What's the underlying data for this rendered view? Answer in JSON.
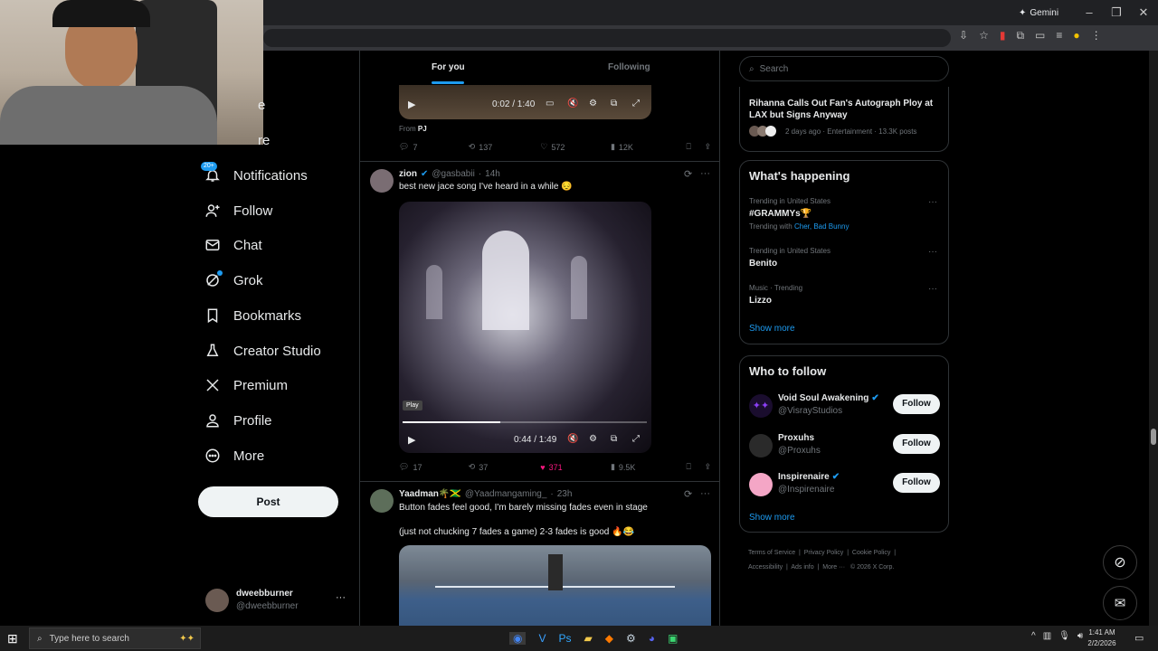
{
  "browser": {
    "gemini_label": "Gemini"
  },
  "tabs": {
    "for_you": "For you",
    "following": "Following"
  },
  "sidebar": {
    "notif_badge": "20+",
    "items": [
      {
        "label": "Notifications",
        "icon": "bell-icon"
      },
      {
        "label": "Follow",
        "icon": "add-user-icon"
      },
      {
        "label": "Chat",
        "icon": "mail-icon"
      },
      {
        "label": "Grok",
        "icon": "grok-icon"
      },
      {
        "label": "Bookmarks",
        "icon": "bookmark-icon"
      },
      {
        "label": "Creator Studio",
        "icon": "flask-icon"
      },
      {
        "label": "Premium",
        "icon": "x-logo-icon"
      },
      {
        "label": "Profile",
        "icon": "person-icon"
      },
      {
        "label": "More",
        "icon": "more-circle-icon"
      }
    ],
    "post_button": "Post",
    "account": {
      "name": "dweebburner",
      "handle": "@dweebburner"
    }
  },
  "post1": {
    "video_time": "0:02 / 1:40",
    "from_label": "From",
    "from_name": "PJ",
    "replies": "7",
    "reposts": "137",
    "likes": "572",
    "views": "12K"
  },
  "post2": {
    "name": "zion",
    "handle": "@gasbabii",
    "time": "14h",
    "text": "best new jace song I've heard in a while 😔",
    "play_tooltip": "Play",
    "video_time": "0:44 / 1:49",
    "progress": 0.4,
    "replies": "17",
    "reposts": "37",
    "likes": "371",
    "views": "9.5K",
    "liked": true
  },
  "post3": {
    "name": "Yaadman🌴🇯🇲",
    "handle": "@Yaadmangaming_",
    "time": "23h",
    "text1": "Button fades feel good, I'm barely missing fades even in stage",
    "text2": "(just not chucking 7 fades a game) 2-3 fades is good 🔥😂"
  },
  "search": {
    "placeholder": "Search"
  },
  "news": {
    "title": "Rihanna Calls Out Fan's Autograph Ploy at LAX but Signs Anyway",
    "meta": "2 days ago · Entertainment · 13.3K posts"
  },
  "happening": {
    "heading": "What's happening",
    "trends": [
      {
        "context": "Trending in United States",
        "name": "#GRAMMYs🏆",
        "with_label": "Trending with",
        "with_links": "Cher, Bad Bunny"
      },
      {
        "context": "Trending in United States",
        "name": "Benito"
      },
      {
        "context": "Music · Trending",
        "name": "Lizzo"
      }
    ],
    "show_more": "Show more"
  },
  "who_to_follow": {
    "heading": "Who to follow",
    "users": [
      {
        "name": "Void Soul Awakening",
        "handle": "@VisrayStudios",
        "verified": true,
        "button": "Follow"
      },
      {
        "name": "Proxuhs",
        "handle": "@Proxuhs",
        "verified": false,
        "button": "Follow"
      },
      {
        "name": "Inspirenaire",
        "handle": "@Inspirenaire",
        "verified": true,
        "button": "Follow"
      }
    ],
    "show_more": "Show more"
  },
  "footer": {
    "links": [
      "Terms of Service",
      "Privacy Policy",
      "Cookie Policy",
      "Accessibility",
      "Ads info",
      "More ···",
      "© 2026 X Corp."
    ]
  },
  "taskbar": {
    "search_placeholder": "Type here to search",
    "time": "1:41 AM",
    "date": "2/2/2026"
  },
  "colors": {
    "accent": "#1d9bf0",
    "like": "#f91880",
    "background": "#000000"
  }
}
